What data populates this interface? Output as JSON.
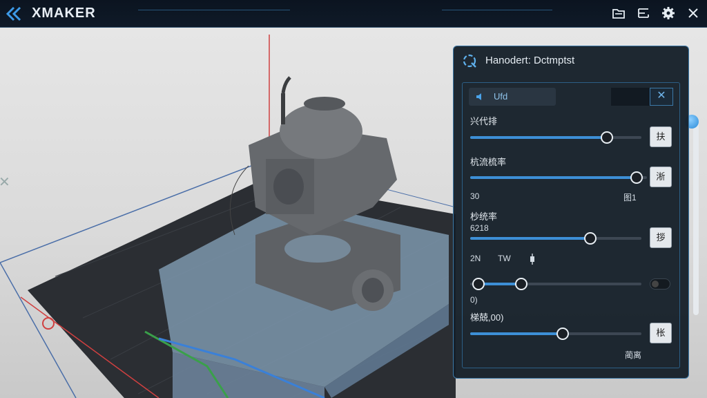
{
  "app": {
    "title": "XMAKER"
  },
  "titlebar_icons": [
    "folder-icon",
    "crop-icon",
    "gear-icon",
    "close-icon"
  ],
  "panel": {
    "title": "Hanodert: Dctmptst",
    "chip_label": "Ufd",
    "close_glyph": "✕",
    "sliders": [
      {
        "label": "兴代排",
        "value": 0.8,
        "button": "扶"
      },
      {
        "label": "杭流梳率",
        "value": 0.94,
        "button": "淅",
        "min_label": "30",
        "max_label": "图1"
      },
      {
        "label": "杪统率",
        "sub": "6218",
        "value": 0.7,
        "button": "拶"
      },
      {
        "mode_labels": [
          "2N",
          "TW"
        ],
        "range": [
          0.05,
          0.3
        ],
        "value_label": "0)"
      },
      {
        "label": "梯兢,00)",
        "value": 0.54,
        "button": "枨",
        "footer": "蔺离"
      }
    ]
  },
  "colors": {
    "accent": "#3d8fd6",
    "panel_bg": "#16202a",
    "border": "#3c79a8"
  }
}
